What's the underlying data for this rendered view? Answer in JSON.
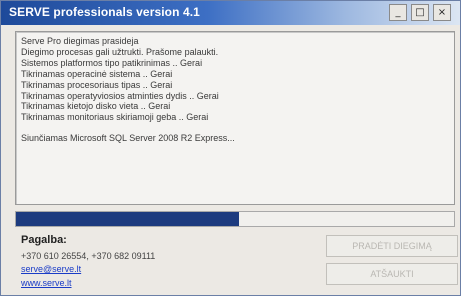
{
  "window": {
    "title": "SERVE professionals version 4.1",
    "controls": {
      "minimize": "_",
      "maximize": "□",
      "close": "×"
    }
  },
  "log": {
    "lines": [
      "Serve Pro diegimas prasideja",
      "Diegimo procesas gali užtrukti. Prašome palaukti.",
      "Sistemos platformos tipo patikrinimas .. Gerai",
      "Tikrinamas operacinė sistema .. Gerai",
      "Tikrinamas procesoriaus tipas .. Gerai",
      "Tikrinamas operatyviosios atminties dydis .. Gerai",
      "Tikrinamas kietojo disko vieta .. Gerai",
      "Tikrinamas monitoriaus skiriamoji geba .. Gerai"
    ],
    "final_line": "Siunčiamas Microsoft SQL Server 2008 R2 Express..."
  },
  "progress": {
    "value": 0.51
  },
  "help": {
    "title": "Pagalba:",
    "phones": "+370 610 26554, +370 682 09111",
    "email": "serve@serve.lt",
    "web": "www.serve.lt"
  },
  "buttons": {
    "primary": "PRADĖTI DIEGIMĄ",
    "secondary": "ATŠAUKTI"
  }
}
